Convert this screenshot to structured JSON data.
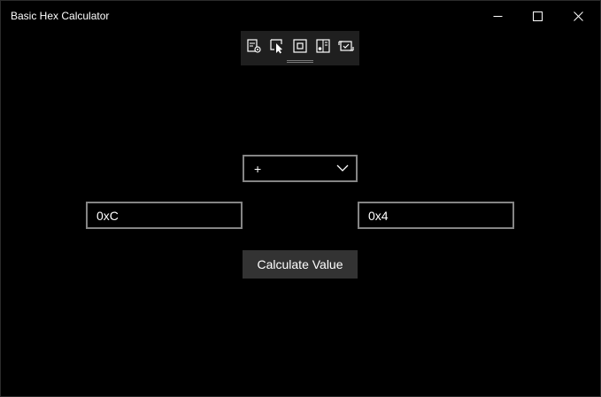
{
  "window": {
    "title": "Basic Hex Calculator",
    "caption_buttons": [
      "minimize-icon",
      "maximize-icon",
      "close-icon"
    ]
  },
  "debug_toolbar": {
    "tools": [
      "live-visual-tree-icon",
      "select-element-icon",
      "display-layout-adorners-icon",
      "track-focus-icon",
      "binding-failures-icon"
    ]
  },
  "calculator": {
    "operator": {
      "selected": "+"
    },
    "first_operand": {
      "value": "0xC"
    },
    "second_operand": {
      "value": "0x4"
    },
    "calculate_label": "Calculate Value"
  },
  "colors": {
    "background": "#000000",
    "control_border": "#858585",
    "button_background": "#333333",
    "toolbar_background": "#1f1f1f",
    "text": "#ffffff"
  }
}
